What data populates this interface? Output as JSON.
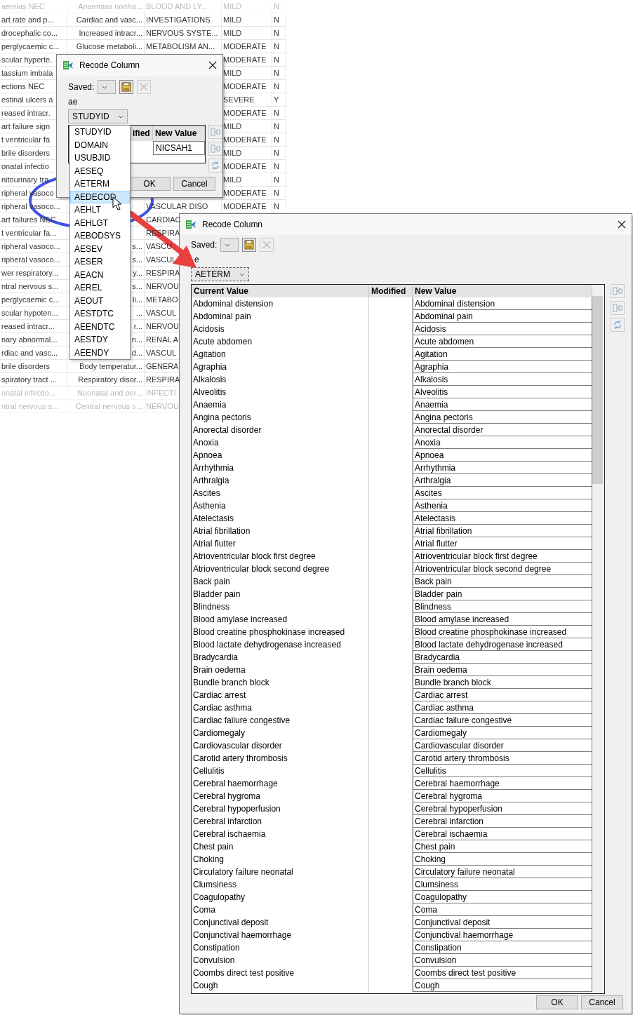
{
  "background_table": {
    "rows": [
      {
        "faded": true,
        "column_1": "aemias NEC",
        "column_2": "Anaemias nonha...",
        "column_3": "BLOOD AND LY...",
        "column_4": "MILD",
        "column_5": "N"
      },
      {
        "faded": false,
        "column_1": "art rate and p...",
        "column_2": "Cardiac and vasc...",
        "column_3": "INVESTIGATIONS",
        "column_4": "MILD",
        "column_5": "N"
      },
      {
        "faded": false,
        "column_1": "drocephalic co...",
        "column_2": "Increased intracr...",
        "column_3": "NERVOUS SYSTE...",
        "column_4": "MILD",
        "column_5": "N"
      },
      {
        "faded": false,
        "column_1": "perglycaemic c...",
        "column_2": "Glucose metaboli...",
        "column_3": "METABOLISM AN...",
        "column_4": "MODERATE",
        "column_5": "N"
      },
      {
        "faded": false,
        "column_1": "scular hyperte.",
        "column_4": "MODERATE",
        "column_5": "N"
      },
      {
        "faded": false,
        "column_1": "tassium imbala",
        "column_4": "MILD",
        "column_5": "N"
      },
      {
        "faded": false,
        "column_1": "ections NEC",
        "column_4": "MODERATE",
        "column_5": "N"
      },
      {
        "faded": false,
        "column_1": "estinal ulcers a",
        "column_4": "SEVERE",
        "column_5": "Y"
      },
      {
        "faded": false,
        "column_1": "reased intracr.",
        "column_4": "MODERATE",
        "column_5": "N"
      },
      {
        "faded": false,
        "column_1": "art failure sign",
        "column_4": "MILD",
        "column_5": "N"
      },
      {
        "faded": false,
        "column_1": "t ventricular fa",
        "column_4": "MODERATE",
        "column_5": "N"
      },
      {
        "faded": false,
        "column_1": "brile disorders",
        "column_4": "MILD",
        "column_5": "N"
      },
      {
        "faded": false,
        "column_1": "onatal infectio",
        "column_4": "MODERATE",
        "column_5": "N"
      },
      {
        "faded": false,
        "column_1": "nitourinary tra",
        "column_4": "MILD",
        "column_5": "N"
      },
      {
        "faded": false,
        "column_1": "ripheral vasoco",
        "column_4": "MODERATE",
        "column_5": "N"
      },
      {
        "faded": false,
        "column_1": "ripheral vasoco...",
        "column_3": "VASCULAR DISO",
        "column_4": "MODERATE",
        "column_5": "N"
      },
      {
        "faded": false,
        "column_1": "art failures NEC",
        "column_3": "CARDIAC"
      },
      {
        "faded": false,
        "column_1": "t ventricular fa...",
        "column_3": "RESPIRA"
      },
      {
        "faded": false,
        "column_1": "ripheral vasoco...",
        "column_2": "s...",
        "column_3": "VASCU"
      },
      {
        "faded": false,
        "column_1": "ripheral vasoco...",
        "column_2": "s...",
        "column_3": "VASCUL"
      },
      {
        "faded": false,
        "column_1": "wer respiratory...",
        "column_2": "y...",
        "column_3": "RESPIRA"
      },
      {
        "faded": false,
        "column_1": "ntral nervous s...",
        "column_2": "s...",
        "column_3": "NERVOU"
      },
      {
        "faded": false,
        "column_1": "perglycaemic c...",
        "column_2": "li...",
        "column_3": "METABO"
      },
      {
        "faded": false,
        "column_1": "scular hypoten...",
        "column_2": "...",
        "column_3": "VASCUL"
      },
      {
        "faded": false,
        "column_1": "reased intracr...",
        "column_2": "r...",
        "column_3": "NERVOU"
      },
      {
        "faded": false,
        "column_1": "nary abnormal...",
        "column_2": "n...",
        "column_3": "RENAL A"
      },
      {
        "faded": false,
        "column_1": "rdiac and vasc...",
        "column_2": "d...",
        "column_3": "VASCUL"
      },
      {
        "faded": false,
        "column_1": "brile disorders",
        "column_2": "Body temperatur...",
        "column_3": "GENERA"
      },
      {
        "faded": false,
        "column_1": "spiratory tract ...",
        "column_2": "Respiratory disor...",
        "column_3": "RESPIRA"
      },
      {
        "faded": true,
        "column_1": "onatal infectio...",
        "column_2": "Neonatal and per...",
        "column_3": "INFECTI"
      },
      {
        "faded": true,
        "column_1": "ntral nervous s...",
        "column_2": "Central nervous s...",
        "column_3": "NERVOU"
      }
    ]
  },
  "small_dialog": {
    "title": "Recode Column",
    "saved_label": "Saved:",
    "table_name": "ae",
    "column_select": "STUDYID",
    "table": {
      "columns": [
        "ified",
        "New Value"
      ],
      "new_value": "NICSAH1"
    },
    "buttons": [
      "OK",
      "Cancel"
    ]
  },
  "dropdown": {
    "items": [
      {
        "label": "STUDYID",
        "selected": false
      },
      {
        "label": "DOMAIN",
        "selected": false
      },
      {
        "label": "USUBJID",
        "selected": false
      },
      {
        "label": "AESEQ",
        "selected": false
      },
      {
        "label": "AETERM",
        "selected": false
      },
      {
        "label": "AEDECOD",
        "selected": true
      },
      {
        "label": "AEHLT",
        "selected": false
      },
      {
        "label": "AEHLGT",
        "selected": false
      },
      {
        "label": "AEBODSYS",
        "selected": false
      },
      {
        "label": "AESEV",
        "selected": false
      },
      {
        "label": "AESER",
        "selected": false
      },
      {
        "label": "AEACN",
        "selected": false
      },
      {
        "label": "AEREL",
        "selected": false
      },
      {
        "label": "AEOUT",
        "selected": false
      },
      {
        "label": "AESTDTC",
        "selected": false
      },
      {
        "label": "AEENDTC",
        "selected": false
      },
      {
        "label": "AESTDY",
        "selected": false
      },
      {
        "label": "AEENDY",
        "selected": false
      }
    ]
  },
  "main_dialog": {
    "title": "Recode Column",
    "saved_label": "Saved:",
    "table_name": "e",
    "column_select": "AETERM",
    "table": {
      "columns": [
        "Current Value",
        "Modified",
        "New Value"
      ],
      "rows": [
        {
          "current": "Abdominal distension",
          "new": "Abdominal distension"
        },
        {
          "current": "Abdominal pain",
          "new": "Abdominal pain"
        },
        {
          "current": "Acidosis",
          "new": "Acidosis"
        },
        {
          "current": "Acute abdomen",
          "new": "Acute abdomen"
        },
        {
          "current": "Agitation",
          "new": "Agitation"
        },
        {
          "current": "Agraphia",
          "new": "Agraphia"
        },
        {
          "current": "Alkalosis",
          "new": "Alkalosis"
        },
        {
          "current": "Alveolitis",
          "new": "Alveolitis"
        },
        {
          "current": "Anaemia",
          "new": "Anaemia"
        },
        {
          "current": "Angina pectoris",
          "new": "Angina pectoris"
        },
        {
          "current": "Anorectal disorder",
          "new": "Anorectal disorder"
        },
        {
          "current": "Anoxia",
          "new": "Anoxia"
        },
        {
          "current": "Apnoea",
          "new": "Apnoea"
        },
        {
          "current": "Arrhythmia",
          "new": "Arrhythmia"
        },
        {
          "current": "Arthralgia",
          "new": "Arthralgia"
        },
        {
          "current": "Ascites",
          "new": "Ascites"
        },
        {
          "current": "Asthenia",
          "new": "Asthenia"
        },
        {
          "current": "Atelectasis",
          "new": "Atelectasis"
        },
        {
          "current": "Atrial fibrillation",
          "new": "Atrial fibrillation"
        },
        {
          "current": "Atrial flutter",
          "new": "Atrial flutter"
        },
        {
          "current": "Atrioventricular block first degree",
          "new": "Atrioventricular block first degree"
        },
        {
          "current": "Atrioventricular block second degree",
          "new": "Atrioventricular block second degree"
        },
        {
          "current": "Back pain",
          "new": "Back pain"
        },
        {
          "current": "Bladder pain",
          "new": "Bladder pain"
        },
        {
          "current": "Blindness",
          "new": "Blindness"
        },
        {
          "current": "Blood amylase increased",
          "new": "Blood amylase increased"
        },
        {
          "current": "Blood creatine phosphokinase increased",
          "new": "Blood creatine phosphokinase increased"
        },
        {
          "current": "Blood lactate dehydrogenase increased",
          "new": "Blood lactate dehydrogenase increased"
        },
        {
          "current": "Bradycardia",
          "new": "Bradycardia"
        },
        {
          "current": "Brain oedema",
          "new": "Brain oedema"
        },
        {
          "current": "Bundle branch block",
          "new": "Bundle branch block"
        },
        {
          "current": "Cardiac arrest",
          "new": "Cardiac arrest"
        },
        {
          "current": "Cardiac asthma",
          "new": "Cardiac asthma"
        },
        {
          "current": "Cardiac failure congestive",
          "new": "Cardiac failure congestive"
        },
        {
          "current": "Cardiomegaly",
          "new": "Cardiomegaly"
        },
        {
          "current": "Cardiovascular disorder",
          "new": "Cardiovascular disorder"
        },
        {
          "current": "Carotid artery thrombosis",
          "new": "Carotid artery thrombosis"
        },
        {
          "current": "Cellulitis",
          "new": "Cellulitis"
        },
        {
          "current": "Cerebral haemorrhage",
          "new": "Cerebral haemorrhage"
        },
        {
          "current": "Cerebral hygroma",
          "new": "Cerebral hygroma"
        },
        {
          "current": "Cerebral hypoperfusion",
          "new": "Cerebral hypoperfusion"
        },
        {
          "current": "Cerebral infarction",
          "new": "Cerebral infarction"
        },
        {
          "current": "Cerebral ischaemia",
          "new": "Cerebral ischaemia"
        },
        {
          "current": "Chest pain",
          "new": "Chest pain"
        },
        {
          "current": "Choking",
          "new": "Choking"
        },
        {
          "current": "Circulatory failure neonatal",
          "new": "Circulatory failure neonatal"
        },
        {
          "current": "Clumsiness",
          "new": "Clumsiness"
        },
        {
          "current": "Coagulopathy",
          "new": "Coagulopathy"
        },
        {
          "current": "Coma",
          "new": "Coma"
        },
        {
          "current": "Conjunctival deposit",
          "new": "Conjunctival deposit"
        },
        {
          "current": "Conjunctival haemorrhage",
          "new": "Conjunctival haemorrhage"
        },
        {
          "current": "Constipation",
          "new": "Constipation"
        },
        {
          "current": "Convulsion",
          "new": "Convulsion"
        },
        {
          "current": "Coombs direct test positive",
          "new": "Coombs direct test positive"
        },
        {
          "current": "Cough",
          "new": "Cough"
        }
      ]
    },
    "buttons": [
      "OK",
      "Cancel"
    ]
  }
}
